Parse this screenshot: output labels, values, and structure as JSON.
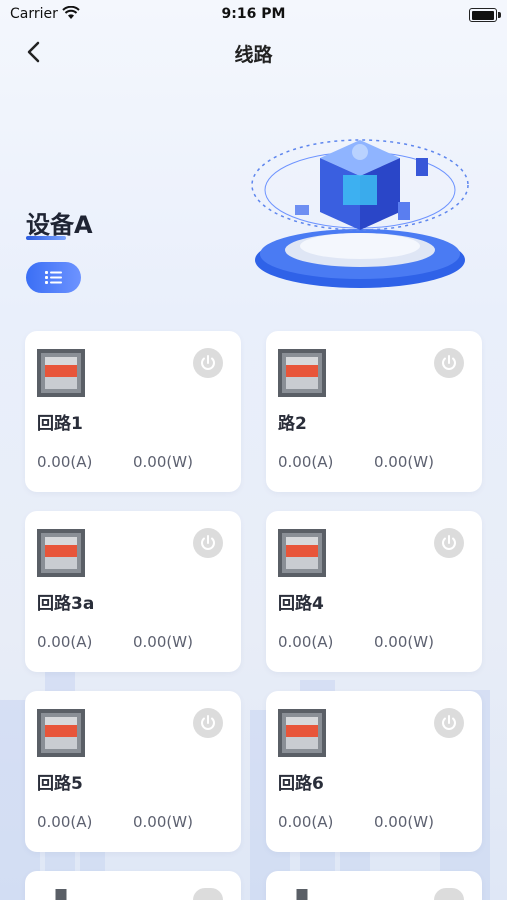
{
  "status_bar": {
    "carrier": "Carrier",
    "time": "9:16 PM",
    "battery_level": 1.0
  },
  "nav": {
    "title": "线路"
  },
  "device": {
    "name": "设备A"
  },
  "circuits": [
    {
      "name": "回路1",
      "current": "0.00(A)",
      "power": "0.00(W)"
    },
    {
      "name": "路2",
      "current": "0.00(A)",
      "power": "0.00(W)"
    },
    {
      "name": "回路3a",
      "current": "0.00(A)",
      "power": "0.00(W)"
    },
    {
      "name": "回路4",
      "current": "0.00(A)",
      "power": "0.00(W)"
    },
    {
      "name": "回路5",
      "current": "0.00(A)",
      "power": "0.00(W)"
    },
    {
      "name": "回路6",
      "current": "0.00(A)",
      "power": "0.00(W)"
    },
    {
      "name": "",
      "current": "",
      "power": ""
    },
    {
      "name": "",
      "current": "",
      "power": ""
    }
  ],
  "colors": {
    "accent": "#3b6ff5",
    "breaker_red": "#e8553a",
    "power_btn": "#dcdcdc"
  },
  "icons": {
    "back": "chevron-left-icon",
    "list": "list-icon",
    "power": "power-icon",
    "breaker": "breaker-switch-icon"
  }
}
